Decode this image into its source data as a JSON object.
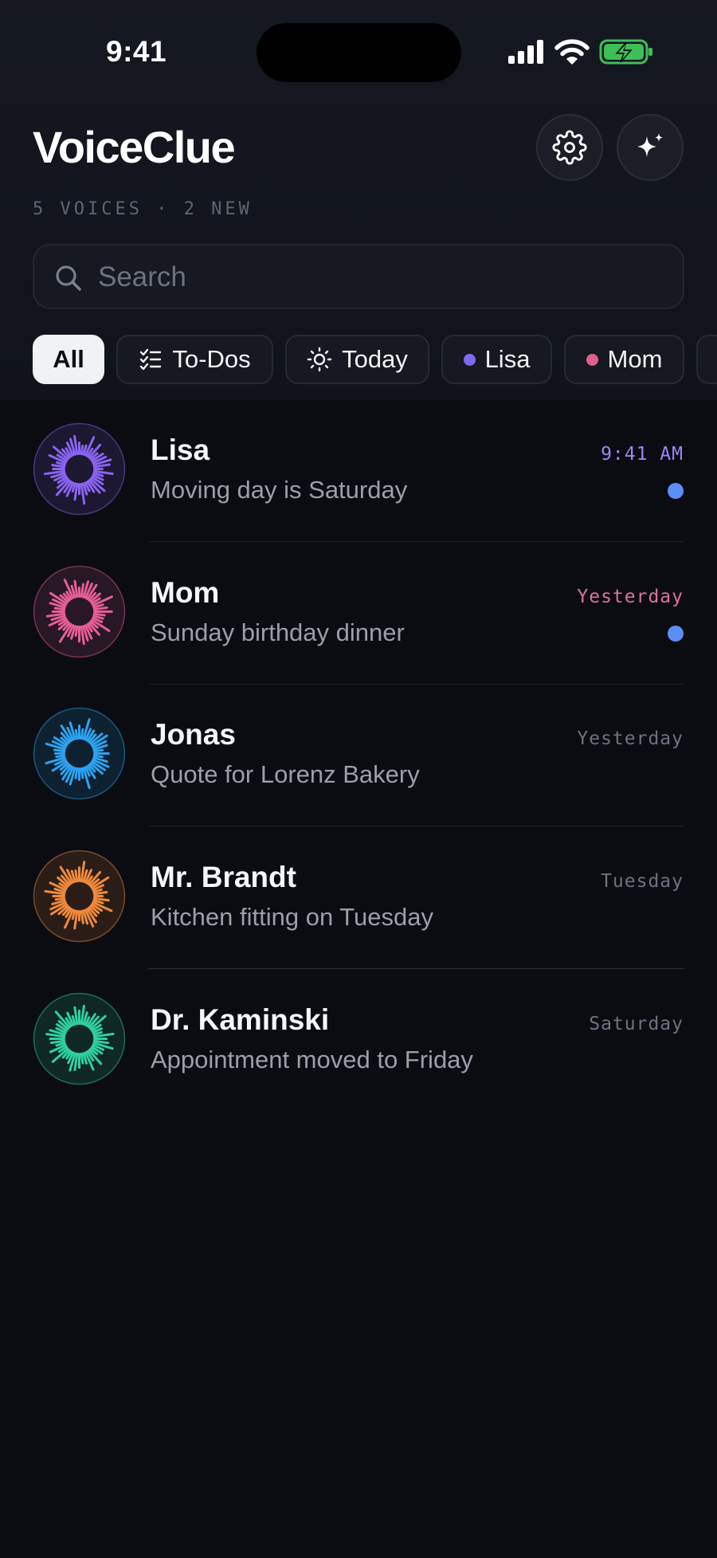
{
  "status_bar": {
    "time": "9:41"
  },
  "header": {
    "title": "VoiceClue",
    "subtitle": "5 VOICES · 2 NEW",
    "settings_icon": "gear-icon",
    "ai_icon": "sparkles-icon"
  },
  "search": {
    "placeholder": "Search",
    "value": ""
  },
  "filters": [
    {
      "label": "All",
      "active": true,
      "icon": ""
    },
    {
      "label": "To-Dos",
      "active": false,
      "icon": "checklist-icon"
    },
    {
      "label": "Today",
      "active": false,
      "icon": "sun-icon"
    },
    {
      "label": "Lisa",
      "active": false,
      "icon": "dot",
      "color": "#7c6af2"
    },
    {
      "label": "Mom",
      "active": false,
      "icon": "dot",
      "color": "#e0608e"
    }
  ],
  "conversations": [
    {
      "name": "Lisa",
      "preview": "Moving day is Saturday",
      "time": "9:41 AM",
      "time_color": "#9b86f0",
      "unread": true,
      "color": "#8b63f2"
    },
    {
      "name": "Mom",
      "preview": "Sunday birthday dinner",
      "time": "Yesterday",
      "time_color": "#e0709b",
      "unread": true,
      "color": "#e55e95"
    },
    {
      "name": "Jonas",
      "preview": "Quote for Lorenz Bakery",
      "time": "Yesterday",
      "time_color": "#6c7280",
      "unread": false,
      "color": "#2da3f0"
    },
    {
      "name": "Mr. Brandt",
      "preview": "Kitchen fitting on Tuesday",
      "time": "Tuesday",
      "time_color": "#6c7280",
      "unread": false,
      "color": "#f08a3c"
    },
    {
      "name": "Dr. Kaminski",
      "preview": "Appointment moved to Friday",
      "time": "Saturday",
      "time_color": "#6c7280",
      "unread": false,
      "color": "#2fd1a0"
    }
  ],
  "colors": {
    "background": "#0a0c12",
    "unread_dot": "#5b8ef5",
    "accent_chip": "#f1f2f4"
  }
}
